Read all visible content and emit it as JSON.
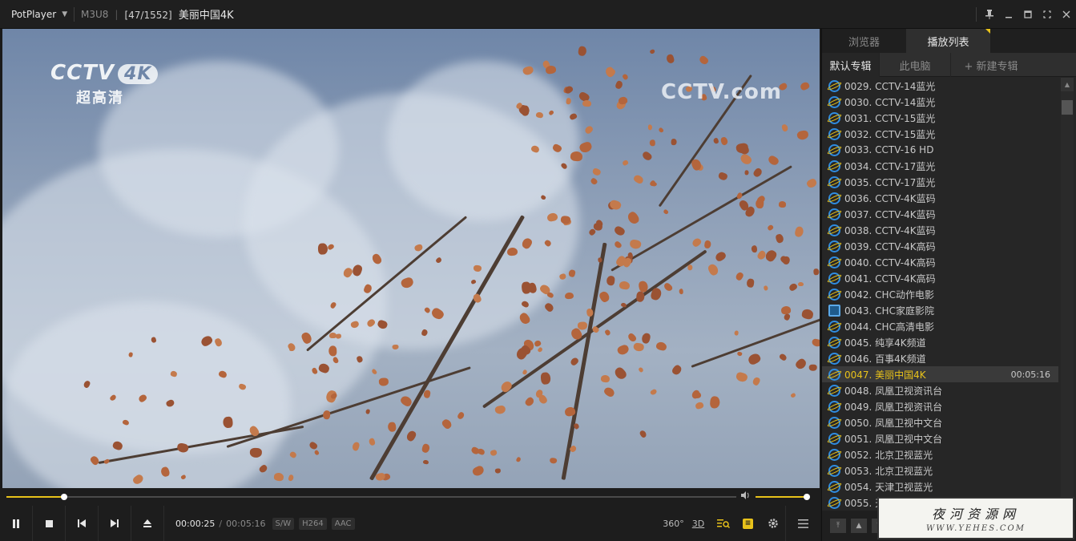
{
  "app": {
    "name": "PotPlayer",
    "format": "M3U8",
    "title_counter": "[47/1552]",
    "title": "美丽中国4K"
  },
  "video": {
    "logo_main": "CCTV",
    "logo_badge": "4K",
    "logo_sub": "超高清",
    "watermark": "CCTV.com"
  },
  "playback": {
    "current_time": "00:00:25",
    "total_time": "00:05:16",
    "progress": 0.079,
    "volume": 1.0,
    "tags": [
      "S/W",
      "H264",
      "AAC"
    ],
    "right_labels": {
      "vr": "360°",
      "three_d": "3D"
    }
  },
  "panel": {
    "tabs": [
      {
        "label": "浏览器",
        "active": false
      },
      {
        "label": "播放列表",
        "active": true
      }
    ],
    "album_tabs": [
      {
        "label": "默认专辑",
        "active": true
      },
      {
        "label": "此电脑",
        "active": false
      },
      {
        "label": "+ 新建专辑",
        "active": false
      }
    ],
    "items": [
      {
        "label": "0029. CCTV-14蓝光",
        "icon": "ie-icon"
      },
      {
        "label": "0030. CCTV-14蓝光",
        "icon": "ie-icon"
      },
      {
        "label": "0031. CCTV-15蓝光",
        "icon": "ie-icon"
      },
      {
        "label": "0032. CCTV-15蓝光",
        "icon": "ie-icon"
      },
      {
        "label": "0033. CCTV-16 HD",
        "icon": "ie-icon"
      },
      {
        "label": "0034. CCTV-17蓝光",
        "icon": "ie-icon"
      },
      {
        "label": "0035. CCTV-17蓝光",
        "icon": "ie-icon"
      },
      {
        "label": "0036. CCTV-4K蓝码",
        "icon": "ie-icon"
      },
      {
        "label": "0037. CCTV-4K蓝码",
        "icon": "ie-icon"
      },
      {
        "label": "0038. CCTV-4K蓝码",
        "icon": "ie-icon"
      },
      {
        "label": "0039. CCTV-4K高码",
        "icon": "ie-icon"
      },
      {
        "label": "0040. CCTV-4K高码",
        "icon": "ie-icon"
      },
      {
        "label": "0041. CCTV-4K高码",
        "icon": "ie-icon"
      },
      {
        "label": "0042. CHC动作电影",
        "icon": "ie-icon"
      },
      {
        "label": "0043. CHC家庭影院",
        "icon": "network-icon"
      },
      {
        "label": "0044. CHC高清电影",
        "icon": "ie-icon"
      },
      {
        "label": "0045. 纯享4K频道",
        "icon": "ie-icon"
      },
      {
        "label": "0046. 百事4K频道",
        "icon": "ie-icon"
      },
      {
        "label": "0047. 美丽中国4K",
        "icon": "ie-icon",
        "duration": "00:05:16",
        "selected": true
      },
      {
        "label": "0048. 凤凰卫视资讯台",
        "icon": "ie-icon"
      },
      {
        "label": "0049. 凤凰卫视资讯台",
        "icon": "ie-icon"
      },
      {
        "label": "0050. 凤凰卫视中文台",
        "icon": "ie-icon"
      },
      {
        "label": "0051. 凤凰卫视中文台",
        "icon": "ie-icon"
      },
      {
        "label": "0052. 北京卫视蓝光",
        "icon": "ie-icon"
      },
      {
        "label": "0053. 北京卫视蓝光",
        "icon": "ie-icon"
      },
      {
        "label": "0054. 天津卫视蓝光",
        "icon": "ie-icon"
      },
      {
        "label": "0055. 天津卫视蓝光",
        "icon": "ie-icon"
      }
    ]
  },
  "watermark_stamp": {
    "line1": "夜河资源网",
    "line2": "WWW.YEHES.COM"
  },
  "colors": {
    "accent": "#e8c21a",
    "background": "#1d1d1d",
    "panel": "#262626",
    "ie_blue": "#2f8ce0"
  }
}
